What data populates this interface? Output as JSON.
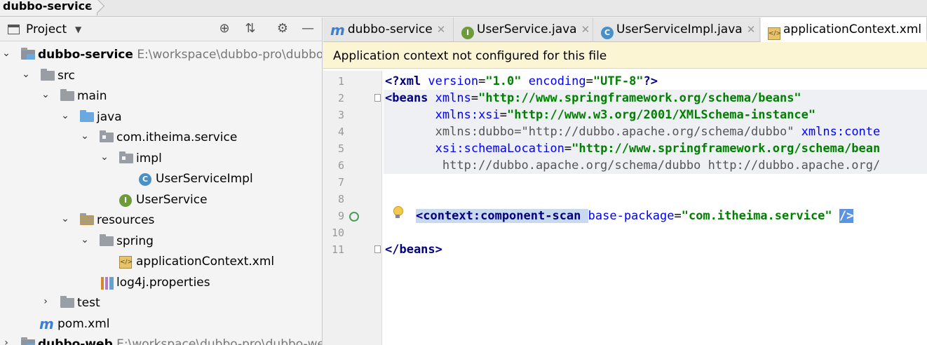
{
  "breadcrumb": "dubbo-service",
  "project_panel": {
    "title": "Project",
    "tree": [
      {
        "label": "dubbo-service",
        "path": "E:\\workspace\\dubbo-pro\\dubbo-",
        "bold": true
      },
      {
        "label": "src"
      },
      {
        "label": "main"
      },
      {
        "label": "java"
      },
      {
        "label": "com.itheima.service"
      },
      {
        "label": "impl"
      },
      {
        "label": "UserServiceImpl"
      },
      {
        "label": "UserService"
      },
      {
        "label": "resources"
      },
      {
        "label": "spring"
      },
      {
        "label": "applicationContext.xml"
      },
      {
        "label": "log4j.properties"
      },
      {
        "label": "test"
      },
      {
        "label": "pom.xml"
      },
      {
        "label": "dubbo-web",
        "path": "E:\\workspace\\dubbo-pro\\dubbo-we",
        "bold": true
      }
    ]
  },
  "tabs": [
    {
      "label": "dubbo-service",
      "icon": "maven-icon"
    },
    {
      "label": "UserService.java",
      "icon": "interface-icon"
    },
    {
      "label": "UserServiceImpl.java",
      "icon": "class-icon"
    },
    {
      "label": "applicationContext.xml",
      "icon": "spring-xml-icon",
      "active": true
    }
  ],
  "banner": "Application context not configured for this file",
  "code": {
    "line_numbers": [
      "1",
      "2",
      "3",
      "4",
      "5",
      "6",
      "7",
      "8",
      "9",
      "10",
      "11"
    ],
    "l1": {
      "open": "<?xml ",
      "a1": "version",
      "v1": "\"1.0\"",
      "a2": " encoding",
      "v2": "\"UTF-8\"",
      "close": "?>"
    },
    "l2": {
      "open": "<beans ",
      "a1": "xmlns",
      "v1": "\"http://www.springframework.org/schema/beans\""
    },
    "l3": {
      "a1": "xmlns:xsi",
      "v1": "\"http://www.w3.org/2001/XMLSchema-instance\""
    },
    "l4": {
      "a1": "xmlns:dubbo",
      "v1": "\"http://dubbo.apache.org/schema/dubbo\"",
      "a2": " xmlns:conte"
    },
    "l5": {
      "a1": "xsi:schemaLocation",
      "v1": "\"http://www.springframework.org/schema/bean"
    },
    "l6": {
      "text": "http://dubbo.apache.org/schema/dubbo http://dubbo.apache.org/"
    },
    "l9": {
      "open": "<context:component-scan ",
      "a1": "base-package",
      "v1": "\"com.itheima.service\"",
      "close": "/>"
    },
    "l11": {
      "text": "</beans>"
    }
  }
}
